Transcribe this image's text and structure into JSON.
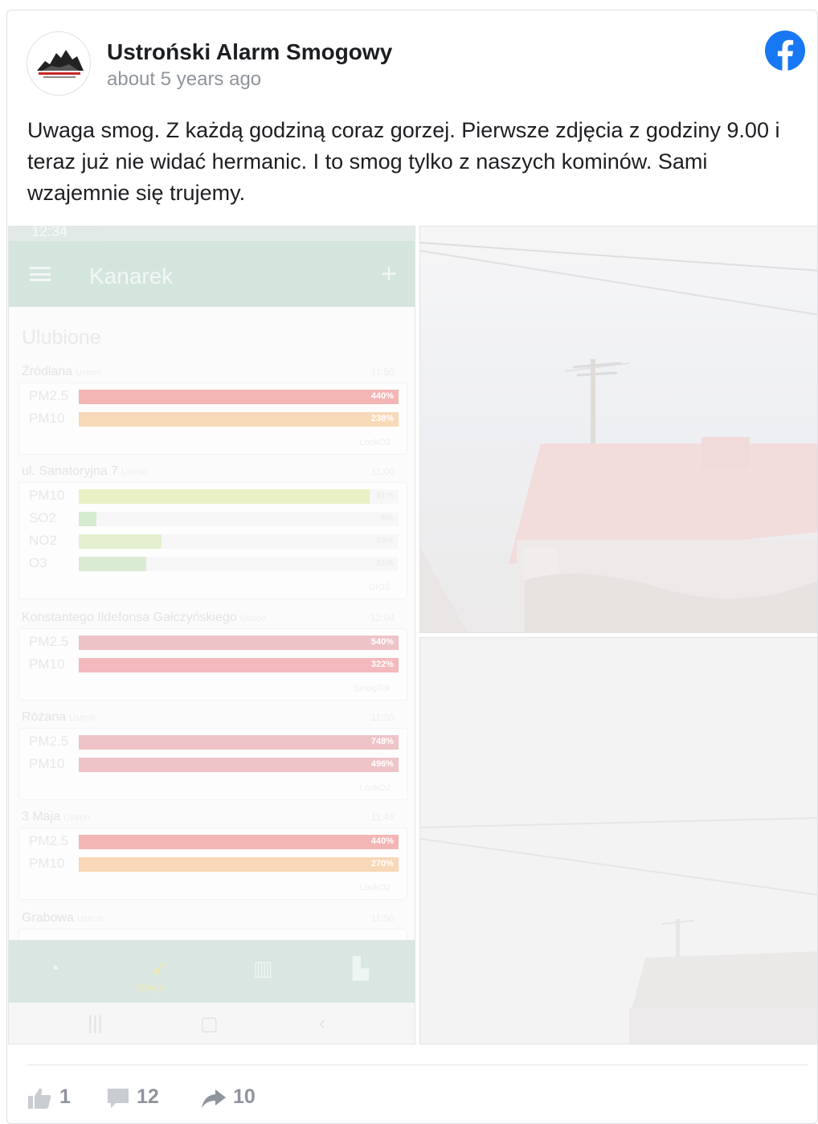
{
  "post": {
    "page_name": "Ustroński Alarm Smogowy",
    "timestamp": "about 5 years ago",
    "text": "Uwaga smog. Z każdą godziną coraz gorzej. Pierwsze zdjęcia z godziny 9.00 i teraz już nie widać hermanic. I to smog tylko z naszych kominów. Sami wzajemnie się trujemy."
  },
  "brand": {
    "facebook_color": "#1877f2"
  },
  "phone": {
    "status_time": "12:34",
    "app_title": "Kanarek",
    "section": "Ulubione",
    "nav_active_label": "Stacje",
    "stations": [
      {
        "name": "Źródlana",
        "city": "Ustroń",
        "time": "11:50",
        "source": "LookO2",
        "rows": [
          {
            "label": "PM2.5",
            "value": "440%",
            "fill": 1.0,
            "color": "#f4b5b5"
          },
          {
            "label": "PM10",
            "value": "238%",
            "fill": 1.0,
            "color": "#f8d9b8"
          }
        ]
      },
      {
        "name": "ul. Sanatoryjna 7",
        "city": "Ustroń",
        "time": "11:00",
        "source": "GIOŚ",
        "rows": [
          {
            "label": "PM10",
            "value": "91%",
            "fill": 0.91,
            "color": "#eaf1c6"
          },
          {
            "label": "SO2",
            "value": "5%",
            "fill": 0.055,
            "color": "#d6ebd0"
          },
          {
            "label": "NO2",
            "value": "26%",
            "fill": 0.26,
            "color": "#e4f0cf"
          },
          {
            "label": "O3",
            "value": "21%",
            "fill": 0.21,
            "color": "#d9ecd3"
          }
        ]
      },
      {
        "name": "Konstantego Ildefonsa Gałczyńskiego",
        "city": "Ustroń",
        "time": "12:04",
        "source": "SmogTok",
        "rows": [
          {
            "label": "PM2.5",
            "value": "540%",
            "fill": 1.0,
            "color": "#eec3c8"
          },
          {
            "label": "PM10",
            "value": "322%",
            "fill": 1.0,
            "color": "#f4b9bd"
          }
        ]
      },
      {
        "name": "Różana",
        "city": "Ustroń",
        "time": "11:50",
        "source": "LookO2",
        "rows": [
          {
            "label": "PM2.5",
            "value": "748%",
            "fill": 1.0,
            "color": "#efc4c9"
          },
          {
            "label": "PM10",
            "value": "496%",
            "fill": 1.0,
            "color": "#eec4c9"
          }
        ]
      },
      {
        "name": "3 Maja",
        "city": "Ustroń",
        "time": "11:49",
        "source": "LookO2",
        "rows": [
          {
            "label": "PM2.5",
            "value": "440%",
            "fill": 1.0,
            "color": "#f4b5b5"
          },
          {
            "label": "PM10",
            "value": "270%",
            "fill": 1.0,
            "color": "#f8d8b6"
          }
        ]
      },
      {
        "name": "Grabowa",
        "city": "Ustroń",
        "time": "11:50",
        "source": "",
        "rows": []
      }
    ]
  },
  "stats": {
    "likes": "1",
    "comments": "12",
    "shares": "10"
  }
}
